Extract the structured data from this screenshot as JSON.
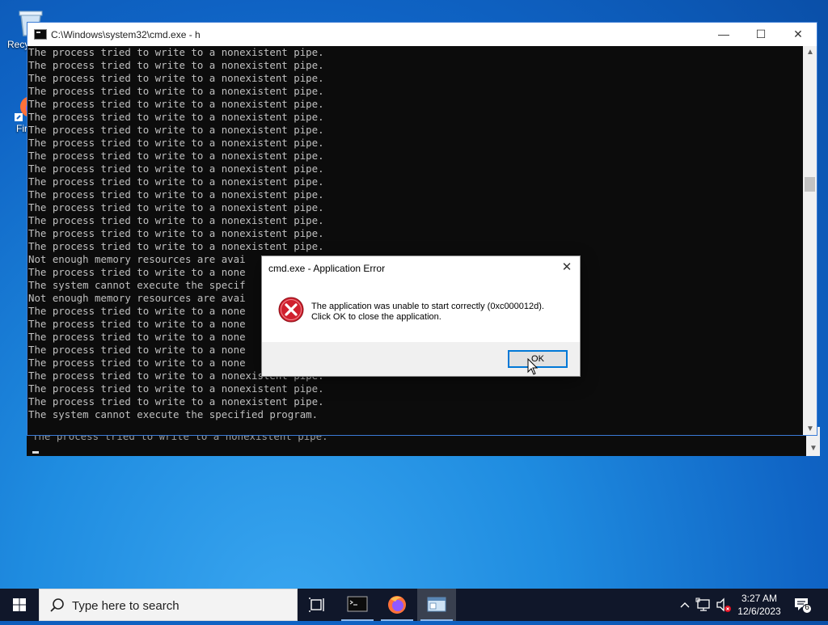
{
  "desktop": {
    "icons": [
      {
        "label": "Recy"
      },
      {
        "label": "Fir"
      }
    ]
  },
  "cmd_window": {
    "title": "C:\\Windows\\system32\\cmd.exe - h",
    "lines": [
      "The process tried to write to a nonexistent pipe.",
      "The process tried to write to a nonexistent pipe.",
      "The process tried to write to a nonexistent pipe.",
      "The process tried to write to a nonexistent pipe.",
      "The process tried to write to a nonexistent pipe.",
      "The process tried to write to a nonexistent pipe.",
      "The process tried to write to a nonexistent pipe.",
      "The process tried to write to a nonexistent pipe.",
      "The process tried to write to a nonexistent pipe.",
      "The process tried to write to a nonexistent pipe.",
      "The process tried to write to a nonexistent pipe.",
      "The process tried to write to a nonexistent pipe.",
      "The process tried to write to a nonexistent pipe.",
      "The process tried to write to a nonexistent pipe.",
      "The process tried to write to a nonexistent pipe.",
      "The process tried to write to a nonexistent pipe.",
      "Not enough memory resources are avai",
      "The process tried to write to a none",
      "The system cannot execute the specif",
      "Not enough memory resources are avai",
      "The process tried to write to a none",
      "The process tried to write to a none",
      "The process tried to write to a none",
      "The process tried to write to a none",
      "The process tried to write to a none",
      "The process tried to write to a nonexistent pipe.",
      "The process tried to write to a nonexistent pipe.",
      "The process tried to write to a nonexistent pipe.",
      "The system cannot execute the specified program."
    ],
    "minimize": "—",
    "maximize": "☐",
    "close": "✕"
  },
  "cmd_window_back": {
    "line": "The process tried to write to a nonexistent pipe."
  },
  "error_dialog": {
    "title": "cmd.exe - Application Error",
    "message_line1": "The application was unable to start correctly (0xc000012d).",
    "message_line2": "Click OK to close the application.",
    "ok_label": "OK",
    "close": "✕"
  },
  "taskbar": {
    "search_placeholder": "Type here to search",
    "time": "3:27 AM",
    "date": "12/6/2023",
    "notification_count": "6"
  },
  "colors": {
    "accent": "#0078d7",
    "error_red": "#d0202e",
    "taskbar": "#10172a"
  }
}
